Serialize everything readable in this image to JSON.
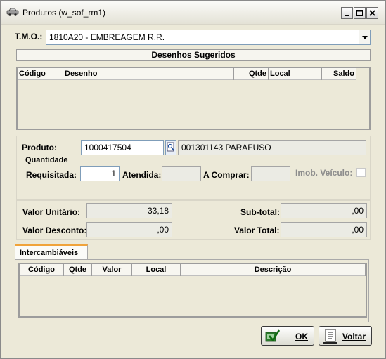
{
  "window": {
    "title": "Produtos (w_sof_rm1)"
  },
  "tmo": {
    "label": "T.M.O.:",
    "value": "1810A20 - EMBREAGEM R.R."
  },
  "desenhos": {
    "title": "Desenhos Sugeridos",
    "columns": [
      "Código",
      "Desenho",
      "Qtde",
      "Local",
      "Saldo"
    ]
  },
  "produto": {
    "label": "Produto:",
    "code": "1000417504",
    "description": "001301143 PARAFUSO"
  },
  "quantidade": {
    "group_label": "Quantidade",
    "requisitada_label": "Requisitada:",
    "requisitada_value": "1",
    "atendida_label": "Atendida:",
    "atendida_value": "",
    "a_comprar_label": "A Comprar:",
    "a_comprar_value": "",
    "imob_label": "Imob. Veículo:"
  },
  "valores": {
    "unitario_label": "Valor Unitário:",
    "unitario_value": "33,18",
    "desconto_label": "Valor Desconto:",
    "desconto_value": ",00",
    "subtotal_label": "Sub-total:",
    "subtotal_value": ",00",
    "total_label": "Valor Total:",
    "total_value": ",00"
  },
  "intercambiaveis": {
    "tab_label": "Intercambiáveis",
    "columns": [
      "Código",
      "Qtde",
      "Valor",
      "Local",
      "Descrição"
    ]
  },
  "buttons": {
    "ok": "OK",
    "voltar": "Voltar"
  },
  "colors": {
    "window_bg": "#ece9d8",
    "tab_accent": "#f0a33a",
    "field_disabled": "#ebebe4"
  }
}
